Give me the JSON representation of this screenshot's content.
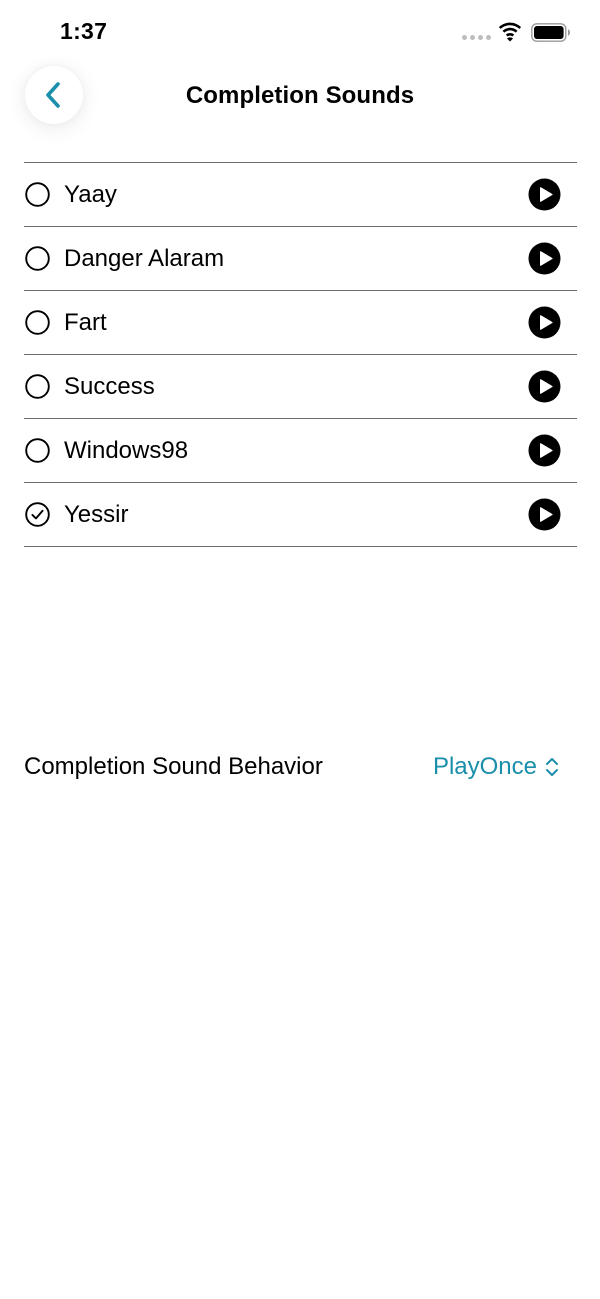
{
  "status_bar": {
    "time": "1:37"
  },
  "nav": {
    "title": "Completion Sounds",
    "back_icon": "chevron-left-icon"
  },
  "sounds": [
    {
      "label": "Yaay",
      "selected": false
    },
    {
      "label": "Danger Alaram",
      "selected": false
    },
    {
      "label": "Fart",
      "selected": false
    },
    {
      "label": "Success",
      "selected": false
    },
    {
      "label": "Windows98",
      "selected": false
    },
    {
      "label": "Yessir",
      "selected": true
    }
  ],
  "behavior": {
    "label": "Completion Sound Behavior",
    "value": "PlayOnce",
    "icon": "chevron-up-down-icon"
  },
  "colors": {
    "accent": "#1a8fab",
    "divider": "#6b6b6b",
    "text": "#000000",
    "background": "#ffffff"
  }
}
